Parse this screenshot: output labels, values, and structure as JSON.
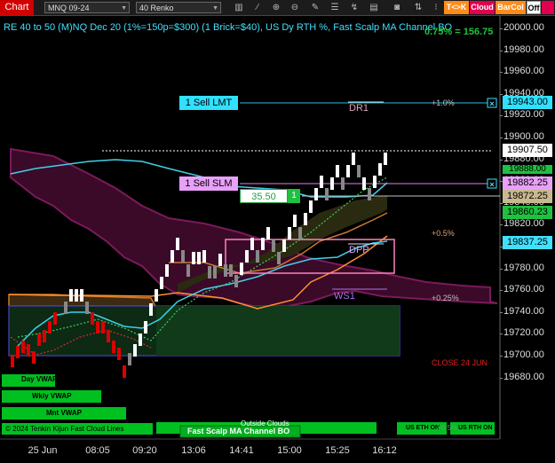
{
  "toolbar": {
    "chart_tab": "Chart",
    "instrument": "MNQ 09-24",
    "period": "40 Renko",
    "icons": [
      "bar-chart-icon",
      "draw-line-icon",
      "zoom-in-icon",
      "zoom-out-icon",
      "strategy-icon",
      "properties-icon",
      "attach-icon",
      "data-box-icon",
      "screenshot-icon",
      "chart-trader-icon"
    ],
    "tk_button": "T<>K",
    "cloud_button": "Cloud",
    "barcol_button": "BarCol",
    "off_button": "Off"
  },
  "chart": {
    "title": "RE 40 to 50 (M)NQ Dec 20 (1%=150p=$300) (1 Brick=$40), US Dy RTH %, Fast Scalp MA Channel BO",
    "top_right_label": "0.75% = 156.75",
    "price_axis": [
      "20000.00",
      "19980.00",
      "19960.00",
      "19940.00",
      "19920.00",
      "19900.00",
      "19880.00",
      "19860.00",
      "19840.00",
      "19820.00",
      "19800.00",
      "19780.00",
      "19760.00",
      "19740.00",
      "19720.00",
      "19700.00",
      "19680.00"
    ],
    "time_axis": [
      "25 Jun",
      "08:05",
      "09:20",
      "13:06",
      "14:41",
      "15:00",
      "15:25",
      "16:12"
    ],
    "markers": {
      "sell_lmt": {
        "label": "1 Sell LMT",
        "price": "19943.00"
      },
      "last_price": "19907.50",
      "hidden_price": "19888.00",
      "sell_slm": {
        "label": "1 Sell SLM",
        "price": "19882.25"
      },
      "position_price": "19872.25",
      "position_pnl": "35.50",
      "position_qty": "1",
      "green_price": "19860.23",
      "cyan_price": "19837.25"
    },
    "levels": {
      "dr1": "DR1",
      "plus_1pct": "+1.0%",
      "plus_05pct": "+0.5%",
      "dpp": "DPP",
      "ws1": "WS1",
      "plus_025pct": "+0.25%",
      "close_label": "CLOSE 24 JUN"
    },
    "vwap_labels": [
      "Day VWAP",
      "Wkly VWAP",
      "Mnt VWAP"
    ],
    "bottom_labels": {
      "copyright": "© 2024 Tenkin Kijun Fast Cloud Lines",
      "outside_clouds": "Outside Clouds",
      "fast_scalp": "Fast Scalp MA Channel BO",
      "us_eth_on": "US ETH ON",
      "us_rth_on": "US RTH ON",
      "faded_pct": "+0.5%"
    }
  }
}
